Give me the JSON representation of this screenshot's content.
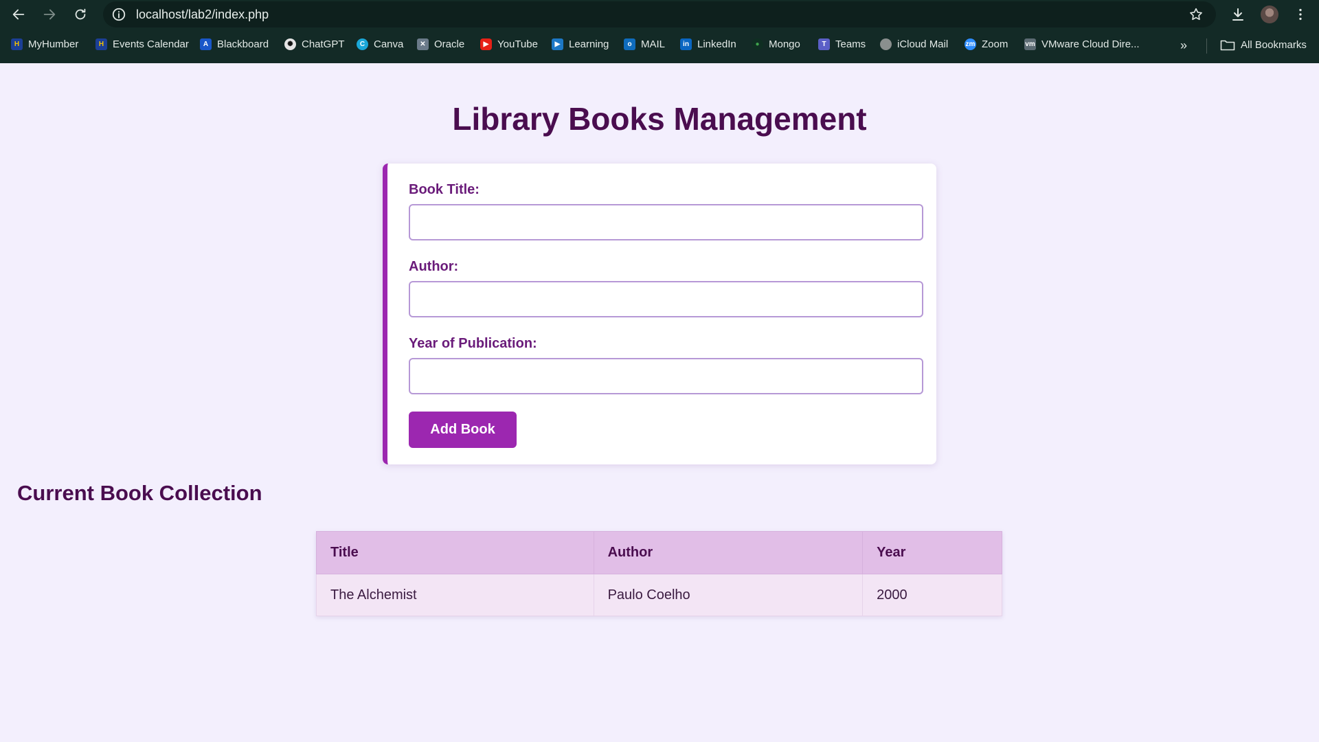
{
  "browser": {
    "url": "localhost/lab2/index.php",
    "bookmarks": [
      "MyHumber",
      "Events Calendar",
      "Blackboard",
      "ChatGPT",
      "Canva",
      "Oracle",
      "YouTube",
      "Learning",
      "MAIL",
      "LinkedIn",
      "Mongo",
      "Teams",
      "iCloud Mail",
      "Zoom",
      "VMware Cloud Dire..."
    ],
    "all_bookmarks_label": "All Bookmarks"
  },
  "page": {
    "title": "Library Books Management",
    "form": {
      "title_label": "Book Title:",
      "title_value": "",
      "author_label": "Author:",
      "author_value": "",
      "year_label": "Year of Publication:",
      "year_value": "",
      "submit_label": "Add Book"
    },
    "collection_heading": "Current Book Collection",
    "table": {
      "headers": [
        "Title",
        "Author",
        "Year"
      ],
      "rows": [
        [
          "The Alchemist",
          "Paulo Coelho",
          "2000"
        ]
      ]
    }
  },
  "colors": {
    "accent": "#9c27b0",
    "heading": "#4a0d4f",
    "page_bg": "#f3effd",
    "table_header_bg": "#e1bee7",
    "table_row_bg": "#f3e5f5"
  }
}
